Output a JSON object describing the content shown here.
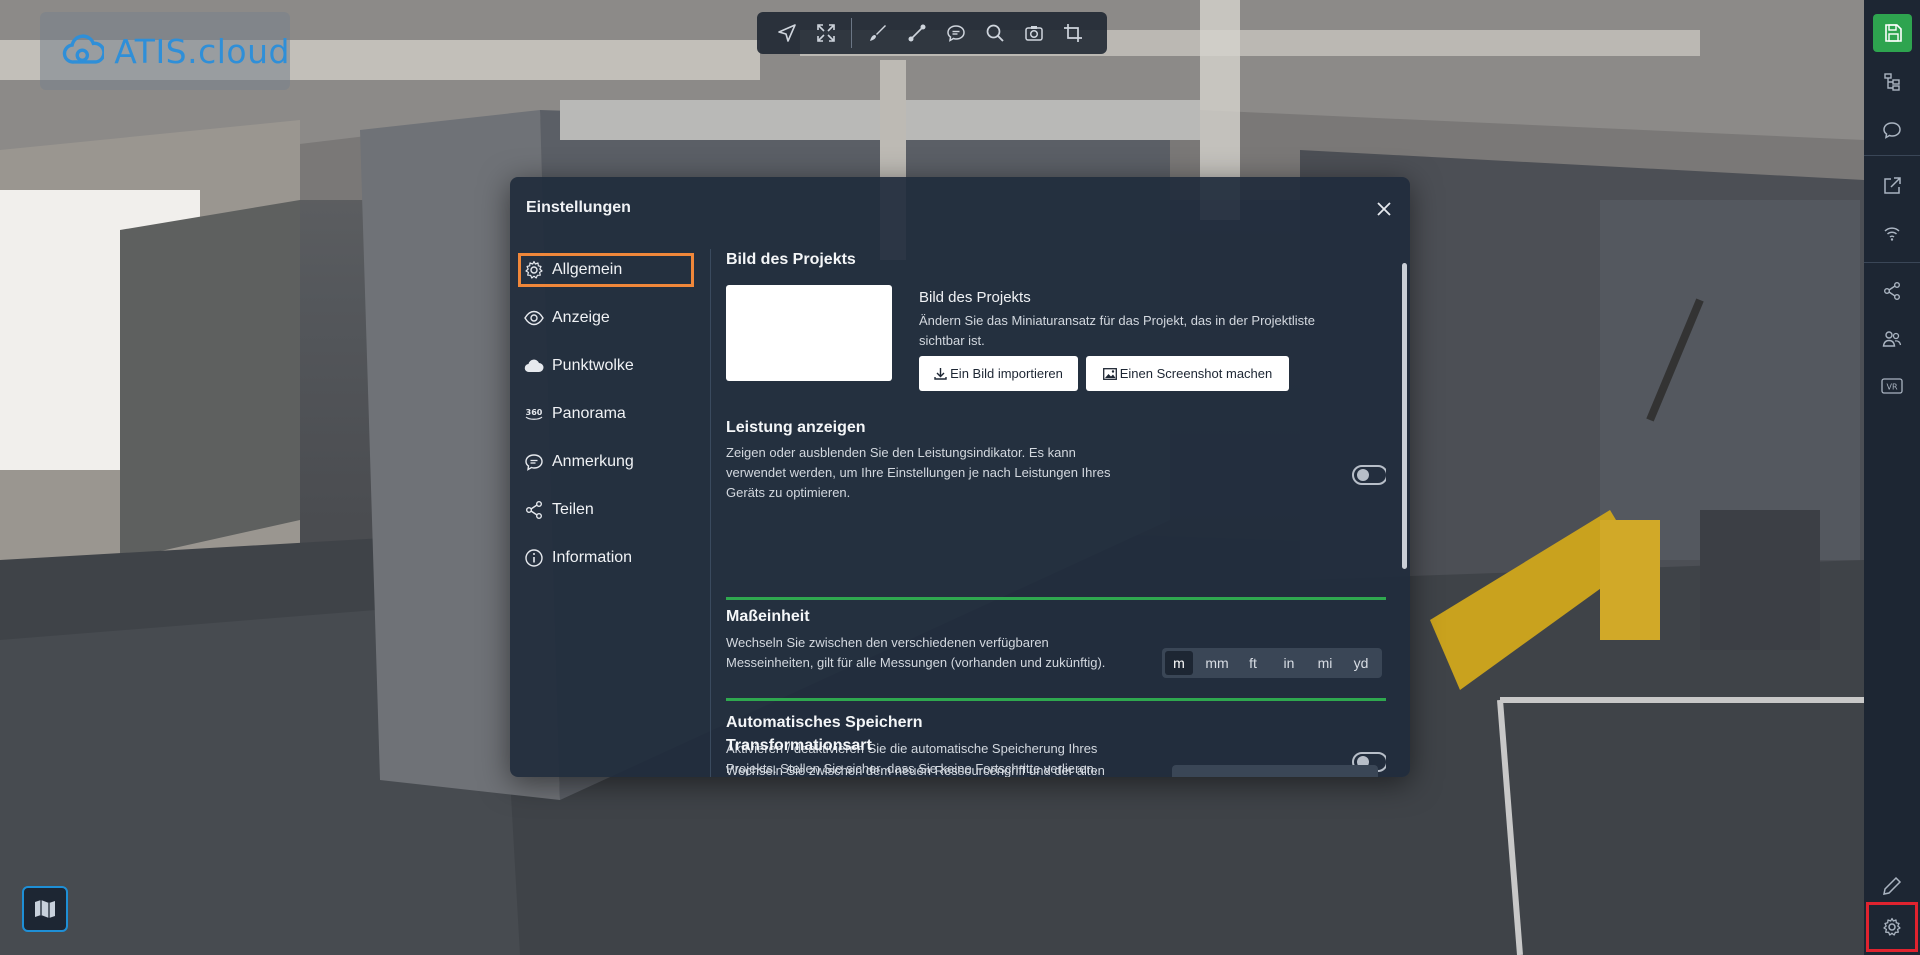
{
  "app": {
    "logo_text": "ATIS.cloud",
    "brand_color": "#2f8fd8"
  },
  "toolbar": {
    "tools": [
      "navigate-icon",
      "fit-view-icon",
      "brush-icon",
      "measure-line-icon",
      "comment-icon",
      "search-icon",
      "camera-icon",
      "crop-icon"
    ]
  },
  "rightbar": {
    "items": [
      "save-icon",
      "tree-icon",
      "comment-icon",
      "external-link-icon",
      "wifi-icon",
      "share-icon",
      "users-icon",
      "vr-icon",
      "pencil-icon",
      "gear-icon"
    ],
    "save_color": "#2ea44f"
  },
  "modal": {
    "title": "Einstellungen",
    "menu": [
      {
        "label": "Allgemein",
        "icon": "gear-icon",
        "active": true
      },
      {
        "label": "Anzeige",
        "icon": "eye-icon"
      },
      {
        "label": "Punktwolke",
        "icon": "cloud-icon"
      },
      {
        "label": "Panorama",
        "icon": "360-icon"
      },
      {
        "label": "Anmerkung",
        "icon": "comment-icon"
      },
      {
        "label": "Teilen",
        "icon": "share-icon"
      },
      {
        "label": "Information",
        "icon": "info-icon"
      }
    ],
    "sections": {
      "project_image": {
        "title": "Bild des Projekts",
        "subtitle": "Bild des Projekts",
        "description": "Ändern Sie das Miniaturansatz für das Projekt, das in der Projektliste sichtbar ist.",
        "import_button": "Ein Bild importieren",
        "screenshot_button": "Einen Screenshot machen"
      },
      "performance": {
        "title": "Leistung anzeigen",
        "description": "Zeigen oder ausblenden Sie den Leistungsindikator. Es kann verwendet werden, um Ihre Einstellungen je nach Leistungen Ihres Geräts zu optimieren.",
        "enabled": false
      },
      "units": {
        "title": "Maßeinheit",
        "description": "Wechseln Sie zwischen den verschiedenen verfügbaren Messeinheiten, gilt für alle Messungen (vorhanden und zukünftig).",
        "options": [
          "m",
          "mm",
          "ft",
          "in",
          "mi",
          "yd"
        ],
        "selected": "m"
      },
      "autosave": {
        "title": "Automatisches Speichern",
        "description": "Aktivieren / deaktivieren Sie die automatische Speicherung Ihres Projekts. Stellen Sie sicher, dass Sie keine Fortschritte verlieren.",
        "enabled": false
      },
      "transform": {
        "title": "Transformationsart",
        "description": "Wechseln Sie zwischen dem neuen Ressourcengriff und der alten"
      }
    }
  },
  "colors": {
    "active_menu_border": "#f0873a",
    "highlight_units_border": "#2fa84f",
    "settings_highlight": "#e0232f"
  }
}
